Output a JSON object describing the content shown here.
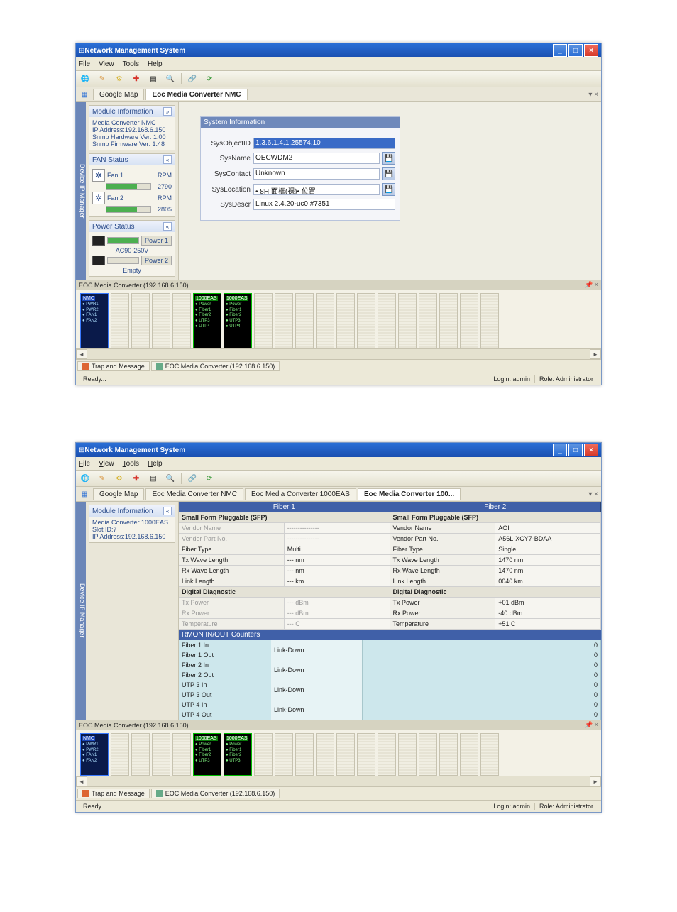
{
  "shot1": {
    "title": "Network Management System",
    "menu": {
      "file": "File",
      "view": "View",
      "tools": "Tools",
      "help": "Help"
    },
    "tabs": {
      "google": "Google Map",
      "nmc": "Eoc Media Converter NMC"
    },
    "sidebar_tab": "Device IP Manager",
    "modinfo": {
      "header": "Module Information",
      "l1": "Media Converter NMC",
      "l2": "IP Address:192.168.6.150",
      "l3": "Snmp Hardware Ver: 1.00",
      "l4": "Snmp Firmware Ver: 1.48"
    },
    "fan": {
      "header": "FAN Status",
      "rpm": "RPM",
      "f1": "Fan 1",
      "f1v": "2790",
      "f2": "Fan 2",
      "f2v": "2805"
    },
    "power": {
      "header": "Power Status",
      "p1": "Power 1",
      "p1s": "AC90-250V",
      "p2": "Power 2",
      "p2s": "Empty"
    },
    "sysinfo": {
      "header": "System Information",
      "k1": "SysObjectID",
      "v1": "1.3.6.1.4.1.25574.10",
      "k2": "SysName",
      "v2": "OECWDM2",
      "k3": "SysContact",
      "v3": "Unknown",
      "k4": "SysLocation",
      "v4": "• 8H 面框(裸)• 位置",
      "k5": "SysDescr",
      "v5": "Linux  2.4.20-uc0  #7351"
    },
    "dock_title": "EOC Media Converter (192.168.6.150)",
    "nmc_module": {
      "l1": "PWR1",
      "l2": "PWR2",
      "l3": "FAN1",
      "l4": "FAN2"
    },
    "slot_module": {
      "t": "1000EAS",
      "l1": "Power",
      "l2": "Fiber1",
      "l3": "Fiber2",
      "l4": "UTP3",
      "l5": "UTP4"
    },
    "bottabs": {
      "t1": "Trap and Message",
      "t2": "EOC Media Converter (192.168.6.150)"
    },
    "status": {
      "ready": "Ready...",
      "login": "Login: admin",
      "role": "Role: Administrator"
    }
  },
  "shot2": {
    "title": "Network Management System",
    "menu": {
      "file": "File",
      "view": "View",
      "tools": "Tools",
      "help": "Help"
    },
    "tabs": {
      "google": "Google Map",
      "nmc": "Eoc Media Converter NMC",
      "eas": "Eoc Media Converter 1000EAS",
      "e100": "Eoc Media Converter 100..."
    },
    "sidebar_tab": "Device IP Manager",
    "modinfo": {
      "header": "Module Information",
      "l1": "Media Converter 1000EAS",
      "l2": "Slot ID:7",
      "l3": "IP Address:192.168.6.150"
    },
    "fiber": {
      "h1": "Fiber 1",
      "h2": "Fiber 2",
      "sfp": "Small Form Pluggable (SFP)",
      "k_vname": "Vendor Name",
      "k_vpart": "Vendor Part No.",
      "k_ftype": "Fiber Type",
      "k_txw": "Tx Wave Length",
      "k_rxw": "Rx Wave Length",
      "k_llen": "Link Length",
      "f1": {
        "vname": "---------------",
        "vpart": "---------------",
        "ftype": "Multi",
        "txw": "--- nm",
        "rxw": "--- nm",
        "llen": "--- km"
      },
      "f2": {
        "vname": "AOI",
        "vpart": "A56L-XCY7-BDAA",
        "ftype": "Single",
        "txw": "1470 nm",
        "rxw": "1470 nm",
        "llen": "0040 km"
      },
      "dd": "Digital Diagnostic",
      "k_txp": "Tx Power",
      "k_rxp": "Rx Power",
      "k_temp": "Temperature",
      "d1": {
        "txp": "--- dBm",
        "rxp": "--- dBm",
        "temp": "--- C"
      },
      "d2": {
        "txp": "+01 dBm",
        "rxp": "-40 dBm",
        "temp": "+51 C"
      }
    },
    "rmon": {
      "header": "RMON IN/OUT Counters",
      "rows": [
        {
          "a": "Fiber 1 In",
          "c": "0"
        },
        {
          "a": "Fiber 1 Out",
          "c": "0"
        },
        {
          "a": "Fiber 2 In",
          "c": "0"
        },
        {
          "a": "Fiber 2 Out",
          "c": "0"
        },
        {
          "a": "UTP 3 In",
          "c": "0"
        },
        {
          "a": "UTP 3 Out",
          "c": "0"
        },
        {
          "a": "UTP 4 In",
          "c": "0"
        },
        {
          "a": "UTP 4 Out",
          "c": "0"
        }
      ],
      "linkdown": "Link-Down"
    },
    "dock_title": "EOC Media Converter (192.168.6.150)",
    "bottabs": {
      "t1": "Trap and Message",
      "t2": "EOC Media Converter (192.168.6.150)"
    },
    "status": {
      "ready": "Ready...",
      "login": "Login: admin",
      "role": "Role: Administrator"
    }
  }
}
